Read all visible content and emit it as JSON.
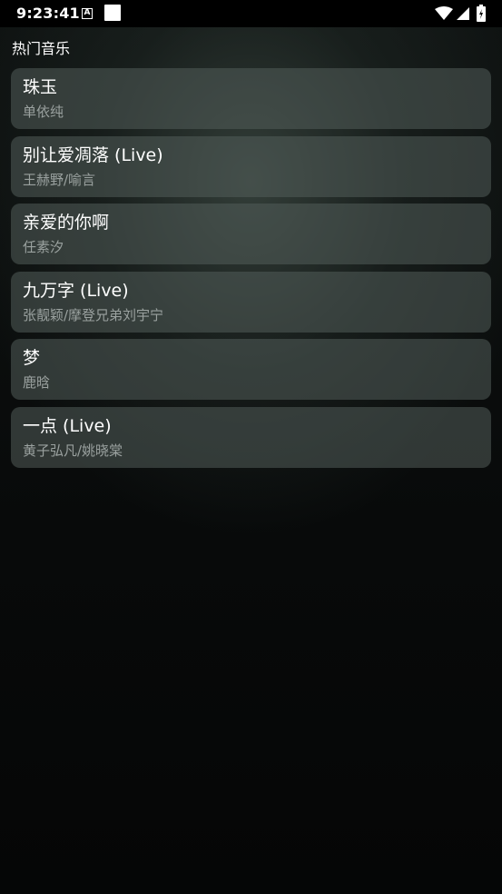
{
  "status_bar": {
    "time": "9:23:41",
    "notification_icon_letter": "A",
    "icons": [
      "a-icon",
      "square-icon",
      "wifi-icon",
      "signal-icon",
      "battery-icon"
    ]
  },
  "header": {
    "title": "热门音乐"
  },
  "songs": [
    {
      "title": "珠玉",
      "artist": "单依纯"
    },
    {
      "title": "别让爱凋落 (Live)",
      "artist": "王赫野/喻言"
    },
    {
      "title": "亲爱的你啊",
      "artist": "任素汐"
    },
    {
      "title": "九万字 (Live)",
      "artist": "张靓颖/摩登兄弟刘宇宁"
    },
    {
      "title": "梦",
      "artist": "鹿晗"
    },
    {
      "title": "一点 (Live)",
      "artist": "黄子弘凡/姚晓棠"
    }
  ],
  "colors": {
    "card_background": "#525c5a",
    "artist_text": "#9aa19f",
    "title_text": "#ffffff",
    "status_bar": "#000000"
  }
}
